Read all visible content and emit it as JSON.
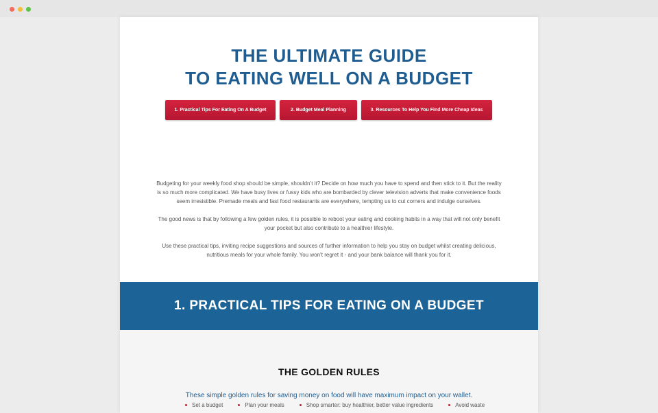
{
  "colors": {
    "brand_blue": "#1f5d91",
    "band_blue": "#1c6497",
    "button_red": "#c41a36"
  },
  "page": {
    "title_line1": "THE ULTIMATE GUIDE",
    "title_line2": "TO EATING WELL ON A BUDGET"
  },
  "nav": {
    "buttons": [
      {
        "label": "1. Practical Tips For Eating On A Budget"
      },
      {
        "label": "2. Budget Meal Planning"
      },
      {
        "label": "3. Resources To Help You Find More Cheap Ideas"
      }
    ]
  },
  "intro": {
    "paragraphs": [
      "Budgeting for your weekly food shop should be simple, shouldn’t it? Decide on how much you have to spend and then stick to it. But the reality is so much more complicated. We have busy lives or fussy kids who are bombarded by clever television adverts that make convenience foods seem irresistible. Premade meals and fast food restaurants are everywhere, tempting us to cut corners and indulge ourselves.",
      "The good news is that by following a few golden rules, it is possible to reboot your eating and cooking habits in a way that will not only benefit your pocket but also contribute to a healthier lifestyle.",
      "Use these practical tips, inviting recipe suggestions and sources of further information to help you stay on budget whilst creating delicious, nutritious meals for your whole family. You won’t regret it - and your bank balance will thank you for it."
    ]
  },
  "section1": {
    "heading": "1. PRACTICAL TIPS FOR EATING ON A BUDGET",
    "rules_title": "THE GOLDEN RULES",
    "rules_intro": "These simple golden rules for saving money on food will have maximum impact on your wallet.",
    "rules": [
      "Set a budget",
      "Plan your meals",
      "Shop smarter: buy healthier, better value ingredients",
      "Avoid waste"
    ]
  }
}
